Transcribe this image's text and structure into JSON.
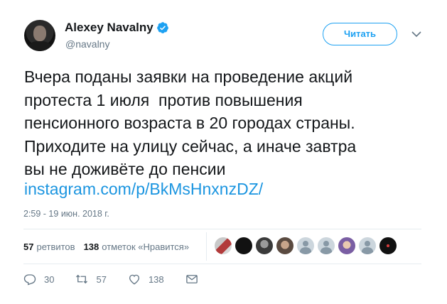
{
  "author": {
    "display_name": "Alexey Navalny",
    "handle": "@navalny"
  },
  "follow_label": "Читать",
  "tweet": {
    "lines": [
      "Вчера поданы заявки на проведение акций",
      "протеста 1 июля  против повышения",
      "пенсионного возраста в 20 городах страны.",
      "Приходите на улицу сейчас, а иначе завтра",
      "вы не доживёте до пенсии"
    ],
    "link": "instagram.com/p/BkMsHnxnzDZ/"
  },
  "timestamp": "2:59 - 19 июн. 2018 г.",
  "stats": {
    "retweets_count": "57",
    "retweets_label": "ретвитов",
    "likes_count": "138",
    "likes_label": "отметок «Нравится»"
  },
  "actions": {
    "reply_count": "30",
    "retweet_count": "57",
    "like_count": "138"
  },
  "colors": {
    "accent": "#1da1f2",
    "link": "#1b95e0",
    "muted": "#657786",
    "border": "#e6ecf0"
  }
}
